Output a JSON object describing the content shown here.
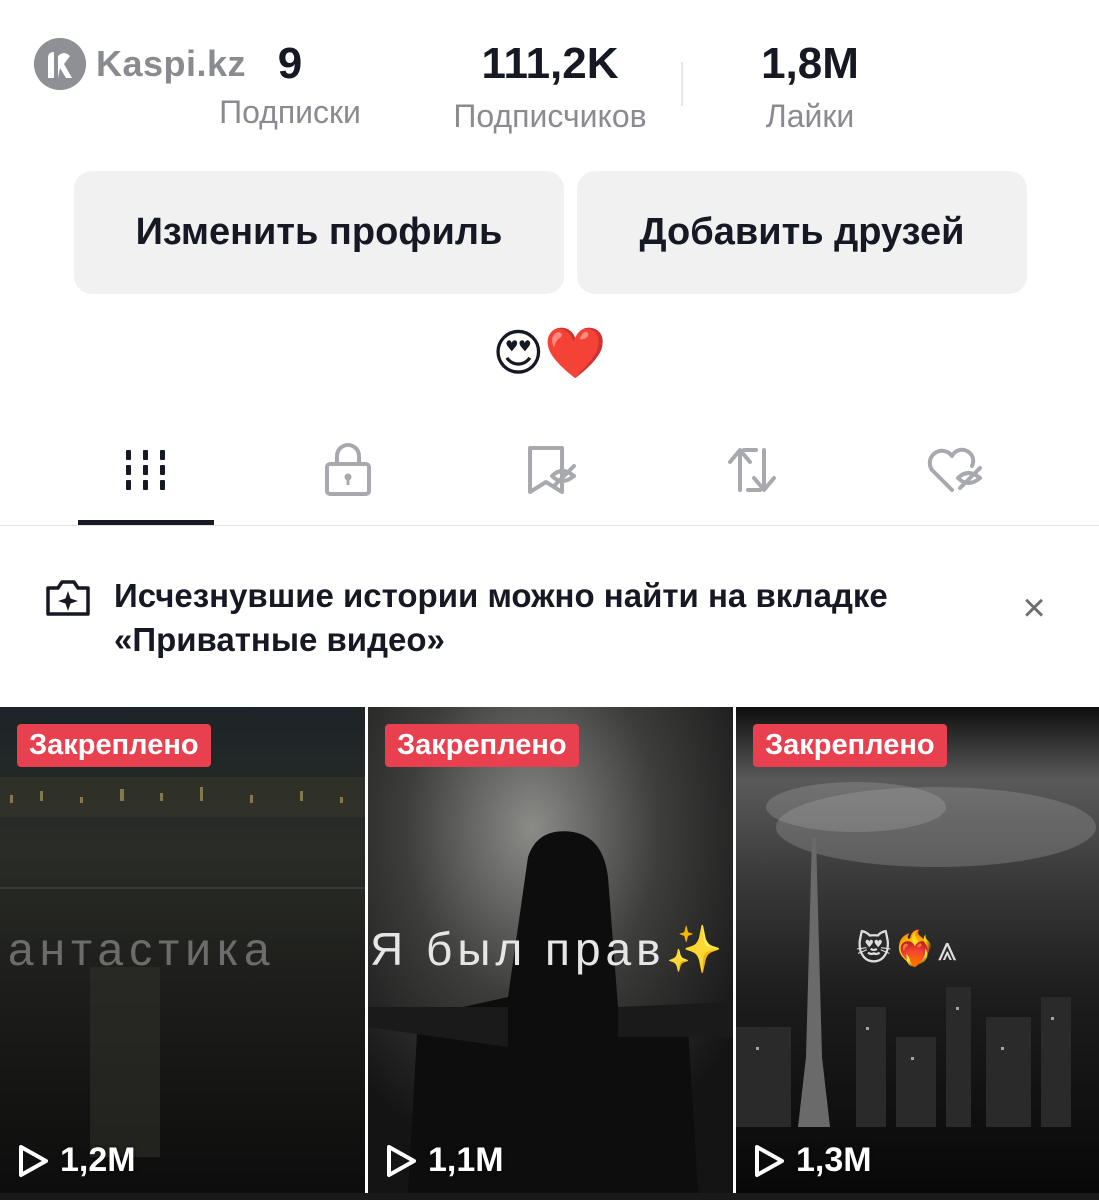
{
  "watermark": {
    "text": "Kaspi.kz",
    "icon": "kaspi-logo-icon"
  },
  "stats": [
    {
      "value": "9",
      "label": "Подписки"
    },
    {
      "value": "111,2K",
      "label": "Подписчиков"
    },
    {
      "value": "1,8M",
      "label": "Лайки"
    }
  ],
  "buttons": {
    "edit_profile": "Изменить профиль",
    "add_friends": "Добавить друзей"
  },
  "bio": "😍❤️",
  "tabs": [
    {
      "name": "videos",
      "icon": "grid-icon",
      "active": true
    },
    {
      "name": "private",
      "icon": "lock-icon",
      "active": false
    },
    {
      "name": "saved",
      "icon": "bookmark-hidden-icon",
      "active": false
    },
    {
      "name": "reposts",
      "icon": "repost-icon",
      "active": false
    },
    {
      "name": "liked",
      "icon": "heart-hidden-icon",
      "active": false
    }
  ],
  "notice": {
    "text": "Исчезнувшие истории можно найти на вкладке «Приватные видео»",
    "icon": "camera-sparkle-icon",
    "close": "×"
  },
  "videos": [
    {
      "pinned_label": "Закреплено",
      "overlay": "антастика",
      "overlay_emoji": "",
      "views": "1,2M"
    },
    {
      "pinned_label": "Закреплено",
      "overlay": "Я был прав",
      "overlay_emoji": "✨",
      "views": "1,1M"
    },
    {
      "pinned_label": "Закреплено",
      "overlay": "",
      "overlay_emoji": "😻❤️‍🔥⩓",
      "views": "1,3M"
    }
  ],
  "colors": {
    "pinned_badge": "#e8404f",
    "text_primary": "#161823",
    "text_secondary": "#8a8b91",
    "button_bg": "#f1f1f2"
  }
}
